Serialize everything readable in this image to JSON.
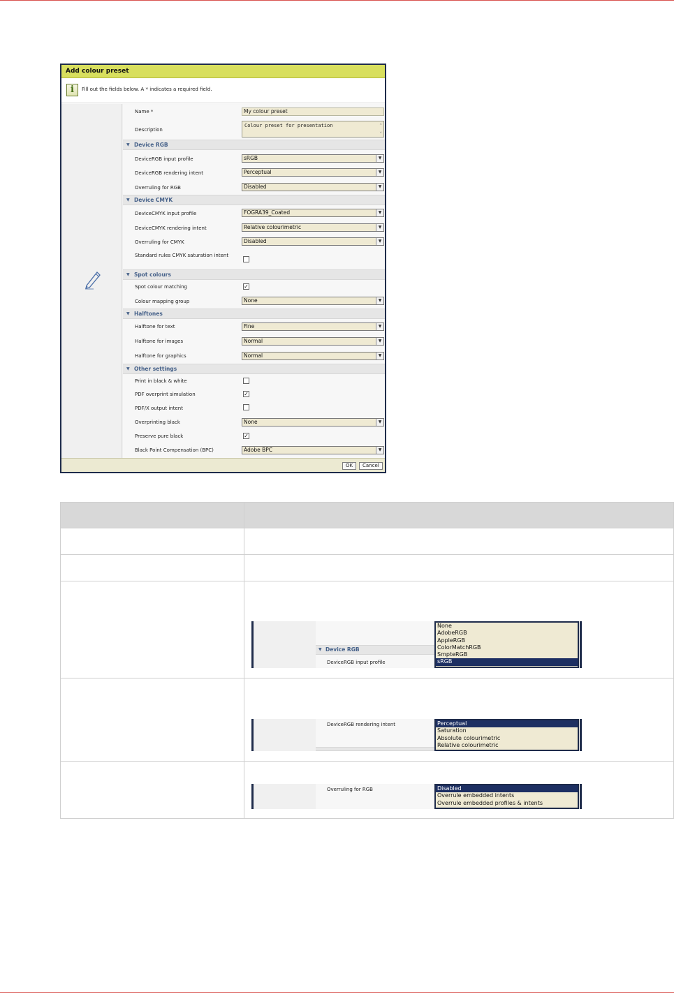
{
  "dialog": {
    "title": "Add colour preset",
    "info": "Fill out the fields below. A * indicates a required field.",
    "name_label": "Name *",
    "name_value": "My colour preset",
    "description_label": "Description",
    "description_value": "Colour preset for presentation",
    "sections": {
      "device_rgb": "Device RGB",
      "device_cmyk": "Device CMYK",
      "spot_colours": "Spot colours",
      "halftones": "Halftones",
      "other_settings": "Other settings"
    },
    "fields": {
      "rgb_input_profile": {
        "label": "DeviceRGB input profile",
        "value": "sRGB"
      },
      "rgb_rendering_intent": {
        "label": "DeviceRGB rendering intent",
        "value": "Perceptual"
      },
      "overruling_rgb": {
        "label": "Overruling for RGB",
        "value": "Disabled"
      },
      "cmyk_input_profile": {
        "label": "DeviceCMYK input profile",
        "value": "FOGRA39_Coated"
      },
      "cmyk_rendering_intent": {
        "label": "DeviceCMYK rendering intent",
        "value": "Relative colourimetric"
      },
      "overruling_cmyk": {
        "label": "Overruling for CMYK",
        "value": "Disabled"
      },
      "cmyk_saturation_intent": {
        "label": "Standard rules CMYK saturation intent",
        "checked": false
      },
      "spot_colour_matching": {
        "label": "Spot colour matching",
        "checked": true
      },
      "colour_mapping_group": {
        "label": "Colour mapping group",
        "value": "None"
      },
      "halftone_text": {
        "label": "Halftone for text",
        "value": "Fine"
      },
      "halftone_images": {
        "label": "Halftone for images",
        "value": "Normal"
      },
      "halftone_graphics": {
        "label": "Halftone for graphics",
        "value": "Normal"
      },
      "print_bw": {
        "label": "Print in black & white",
        "checked": false
      },
      "pdf_overprint": {
        "label": "PDF overprint simulation",
        "checked": true
      },
      "pdfx_output_intent": {
        "label": "PDF/X output intent",
        "checked": false
      },
      "overprinting_black": {
        "label": "Overprinting black",
        "value": "None"
      },
      "preserve_pure_black": {
        "label": "Preserve pure black",
        "checked": true
      },
      "bpc": {
        "label": "Black Point Compensation (BPC)",
        "value": "Adobe BPC"
      }
    },
    "ok_label": "OK",
    "cancel_label": "Cancel"
  },
  "table": {
    "snippet1": {
      "section": "Device RGB",
      "label": "DeviceRGB input profile",
      "options": [
        "None",
        "AdobeRGB",
        "AppleRGB",
        "ColorMatchRGB",
        "SmpteRGB",
        "sRGB"
      ],
      "selected": "sRGB"
    },
    "snippet2": {
      "label": "DeviceRGB rendering intent",
      "options": [
        "Perceptual",
        "Saturation",
        "Absolute colourimetric",
        "Relative colourimetric"
      ],
      "selected": "Perceptual"
    },
    "snippet3": {
      "label": "Overruling for RGB",
      "options": [
        "Disabled",
        "Overrule embedded intents",
        "Overrule embedded profiles & intents"
      ],
      "selected": "Disabled"
    }
  },
  "colors": {
    "title_bar": "#d8df5e",
    "dialog_border": "#1f2c4b",
    "field_bg": "#efead3",
    "section_text": "#47628a",
    "highlight": "#1d2f62",
    "page_rule": "#d9534f"
  }
}
